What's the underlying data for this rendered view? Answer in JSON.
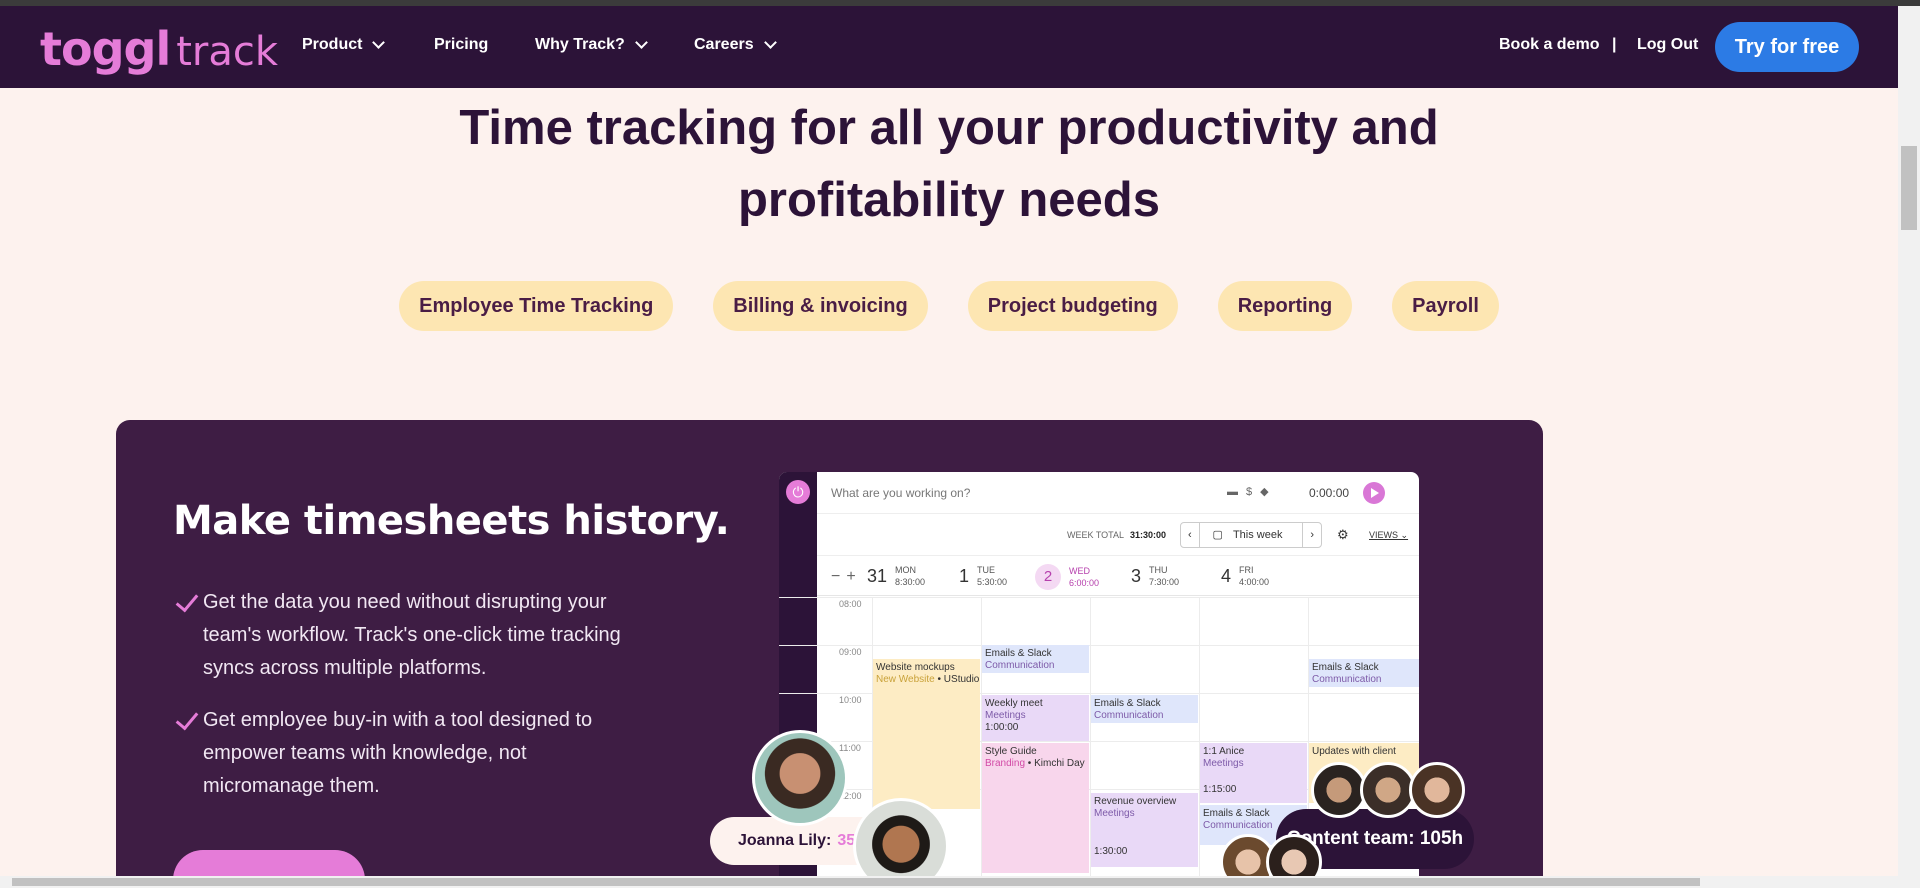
{
  "nav": {
    "logo_main": "toggl",
    "logo_sub": "track",
    "items": [
      {
        "label": "Product",
        "dropdown": true
      },
      {
        "label": "Pricing",
        "dropdown": false
      },
      {
        "label": "Why Track?",
        "dropdown": true
      },
      {
        "label": "Careers",
        "dropdown": true
      }
    ],
    "book_demo": "Book a demo",
    "separator": "|",
    "log_out": "Log Out",
    "try_free": "Try for free"
  },
  "hero": {
    "title_line1": "Time tracking for all your productivity and",
    "title_line2": "profitability needs",
    "pills": [
      "Employee Time Tracking",
      "Billing & invoicing",
      "Project budgeting",
      "Reporting",
      "Payroll"
    ]
  },
  "card": {
    "title": "Make timesheets history.",
    "bullets": [
      "Get the data you need without disrupting your team's workflow. Track's one-click time tracking syncs across multiple platforms.",
      "Get employee buy-in with a tool designed to empower teams with knowledge, not micromanage them."
    ]
  },
  "app": {
    "search_placeholder": "What are you working on?",
    "timer": "0:00:00",
    "week_total_label": "WEEK TOTAL",
    "week_total": "31:30:00",
    "week_label": "This week",
    "views_label": "VIEWS",
    "days": [
      {
        "num": "31",
        "name": "MON",
        "total": "8:30:00"
      },
      {
        "num": "1",
        "name": "TUE",
        "total": "5:30:00"
      },
      {
        "num": "2",
        "name": "WED",
        "total": "6:00:00"
      },
      {
        "num": "3",
        "name": "THU",
        "total": "7:30:00"
      },
      {
        "num": "4",
        "name": "FRI",
        "total": "4:00:00"
      }
    ],
    "hours": [
      "08:00",
      "09:00",
      "10:00",
      "11:00",
      "12:00"
    ],
    "events": {
      "mon1_title": "Website mockups",
      "mon1_proj": "New Website",
      "mon1_client": "UStudio",
      "tue1_title": "Emails & Slack",
      "tue1_proj": "Communication",
      "tue2_title": "Weekly meet",
      "tue2_proj": "Meetings",
      "tue2_dur": "1:00:00",
      "tue3_title": "Style Guide",
      "tue3_proj": "Branding",
      "tue3_client": "Kimchi Day",
      "wed1_title": "Emails & Slack",
      "wed1_proj": "Communication",
      "wed2_title": "Revenue overview",
      "wed2_proj": "Meetings",
      "wed2_dur": "1:30:00",
      "thu1_title": "1:1 Anice",
      "thu1_proj": "Meetings",
      "thu1_dur": "1:15:00",
      "thu2_title": "Emails & Slack",
      "thu2_proj": "Communication",
      "fri1_title": "Emails & Slack",
      "fri1_proj": "Communication",
      "fri2_title": "Updates with client"
    }
  },
  "badges": {
    "joanna_name": "Joanna Lily:",
    "joanna_value": "35",
    "content_team": "Content team: 105h"
  }
}
